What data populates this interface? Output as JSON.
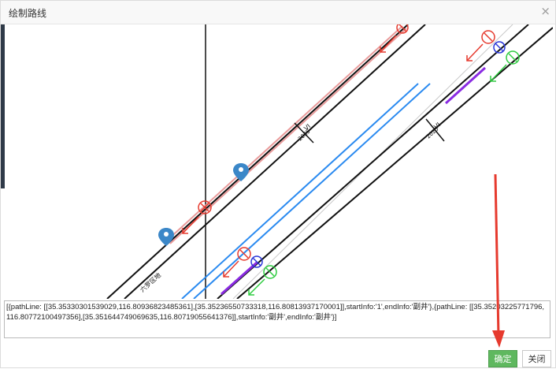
{
  "window": {
    "title": "绘制路线",
    "close_glyph": "×"
  },
  "map": {
    "road_labels": [
      "VI",
      "2025",
      "VI",
      "2025",
      "六罗区地"
    ],
    "valve_glyph": "⊗"
  },
  "path_output": {
    "value": "[{pathLine: [[35.35330301539029,116.80936823485361],[35.35236550733318,116.80813937170001]],startInfo:'1',endInfo:'副井'},{pathLine: [[35.35203225771796,116.80772100497356],[35.351644749069635,116.80719055641376]],startInfo:'副井',endInfo:'副井'}]"
  },
  "footer": {
    "confirm_label": "确定",
    "close_label": "关闭"
  },
  "colors": {
    "confirm_bg": "#5fb85f",
    "annotation_arrow": "#e63a2e",
    "route_blue": "#2a8af0",
    "marker_blue": "#3b87c8"
  }
}
